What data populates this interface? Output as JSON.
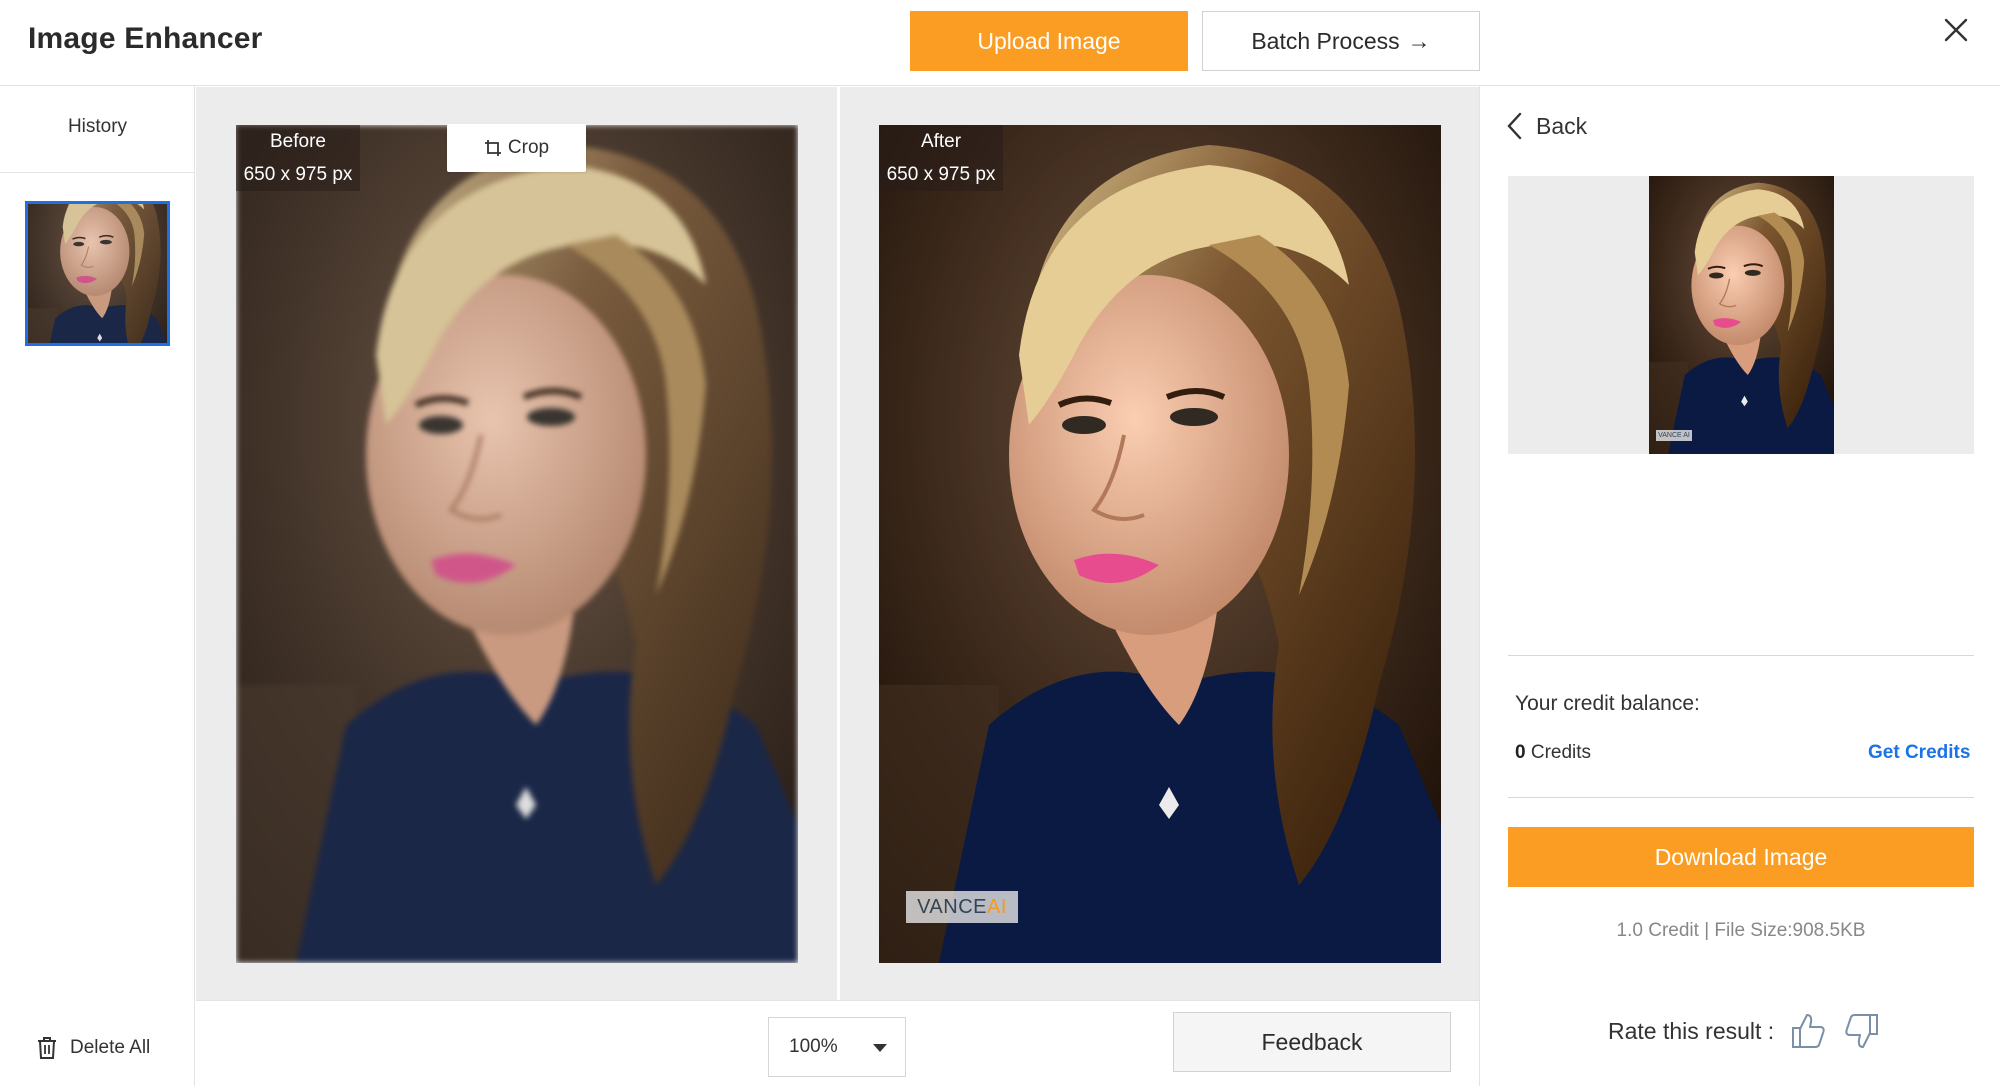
{
  "header": {
    "title": "Image Enhancer",
    "upload_label": "Upload Image",
    "batch_label": "Batch Process",
    "batch_arrow": "→"
  },
  "sidebar": {
    "history_label": "History",
    "delete_all_label": "Delete All"
  },
  "compare": {
    "before": {
      "title": "Before",
      "size": "650 x 975 px"
    },
    "after": {
      "title": "After",
      "size": "650 x 975 px"
    },
    "crop_label": "Crop",
    "watermark_main": "VANCE",
    "watermark_ai": "AI"
  },
  "bottom": {
    "zoom_value": "100%",
    "feedback_label": "Feedback"
  },
  "right_panel": {
    "back_label": "Back",
    "preview_watermark": "VANCE AI",
    "credit_title": "Your credit balance:",
    "credit_amount": "0",
    "credit_unit": "Credits",
    "get_credits_label": "Get Credits",
    "download_label": "Download Image",
    "file_info": "1.0 Credit | File Size:908.5KB",
    "rate_label": "Rate this result :"
  },
  "colors": {
    "accent": "#fb9d23",
    "link": "#1a73e8",
    "selected_border": "#1f6fe5",
    "panel_bg": "#ececec"
  },
  "icons": {
    "close": "close-icon",
    "crop": "crop-icon",
    "back": "chevron-left-icon",
    "trash": "trash-icon",
    "thumb_up": "thumb-up-icon",
    "thumb_down": "thumb-down-icon",
    "dropdown": "caret-down-icon"
  }
}
